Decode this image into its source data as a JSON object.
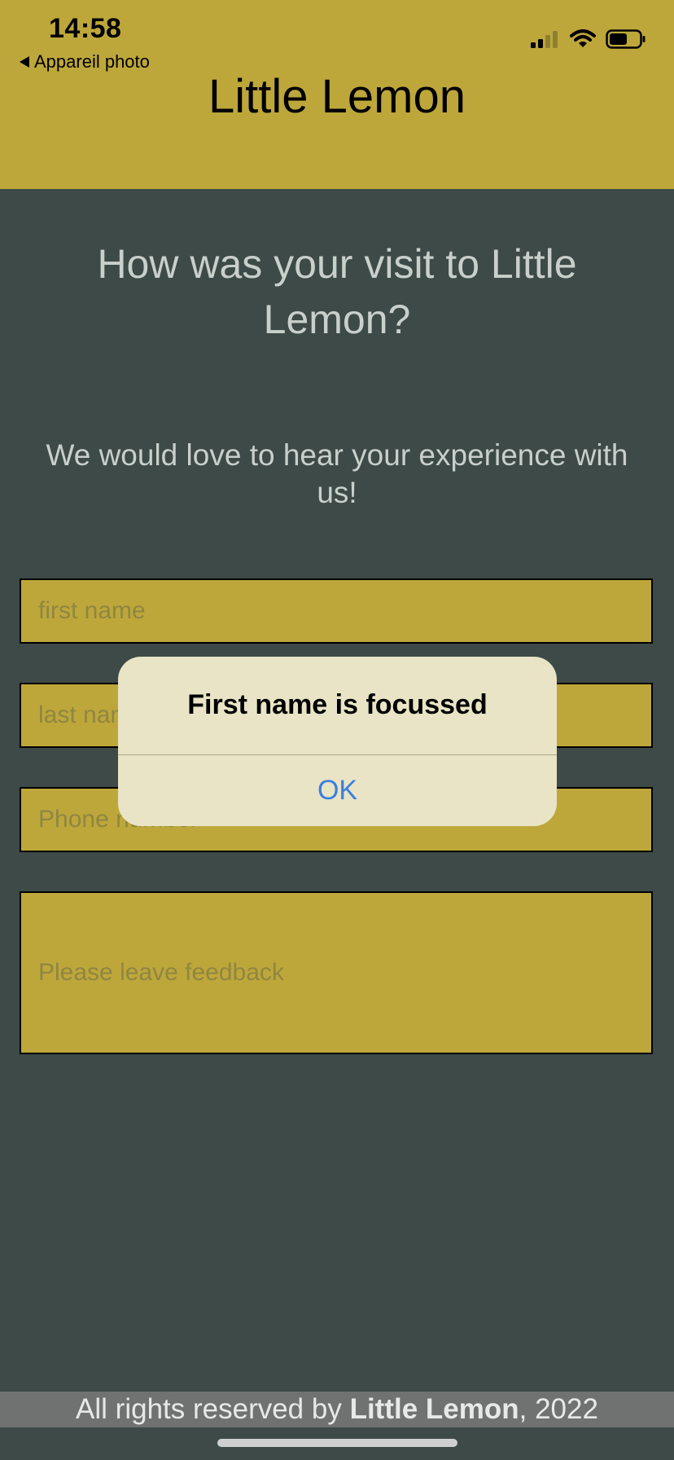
{
  "status_bar": {
    "time": "14:58",
    "back_label": "Appareil photo"
  },
  "header": {
    "title": "Little Lemon"
  },
  "main": {
    "heading": "How was your visit to Little Lemon?",
    "subheading": "We would love to hear your experience with us!",
    "fields": {
      "first_name_placeholder": "first name",
      "last_name_placeholder": "last name",
      "phone_placeholder": "Phone number",
      "feedback_placeholder": "Please leave feedback"
    }
  },
  "footer": {
    "prefix": "All rights reserved by ",
    "brand": "Little Lemon",
    "suffix": ", 2022"
  },
  "alert": {
    "title": "First name is focussed",
    "ok_label": "OK"
  },
  "colors": {
    "header_bg": "#bea73a",
    "page_bg": "#3d4a47",
    "alert_bg": "#e8e4c5",
    "alert_button": "#3a7ee0"
  },
  "icons": [
    "back-arrow-icon",
    "cellular-signal-icon",
    "wifi-icon",
    "battery-icon"
  ]
}
